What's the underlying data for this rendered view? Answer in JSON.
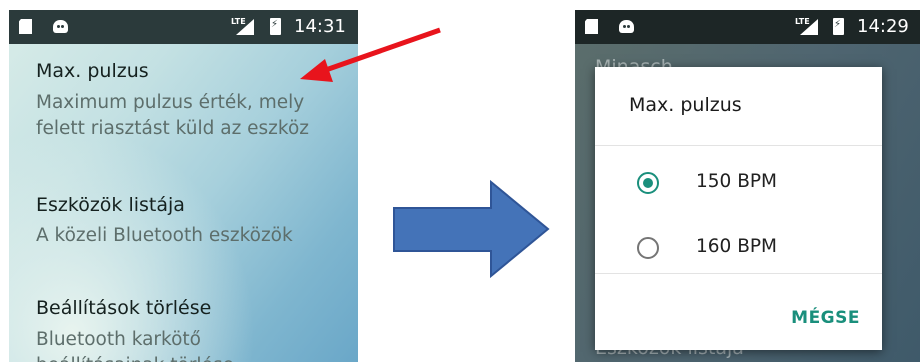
{
  "left_screen": {
    "status": {
      "network": "LTE",
      "time": "14:31",
      "icons": [
        "sim-icon",
        "android-icon",
        "signal-icon",
        "battery-charging-icon"
      ]
    },
    "preferences": [
      {
        "title": "Max. pulzus",
        "summary_line1": "Maximum pulzus érték, mely",
        "summary_line2": "felett riasztást küld az eszköz"
      },
      {
        "title": "Eszközök listája",
        "summary_line1": "A közeli Bluetooth eszközök"
      },
      {
        "title": "Beállítások törlése",
        "summary_line1": "Bluetooth karkötő",
        "summary_line2": "beállításainak törlése"
      }
    ]
  },
  "right_screen": {
    "status": {
      "network": "LTE",
      "time": "14:29",
      "icons": [
        "sim-icon",
        "android-icon",
        "signal-icon",
        "battery-charging-icon"
      ]
    },
    "background_top_text": "Minasch",
    "background_bottom_text": "Eszközök listája",
    "dialog": {
      "title": "Max. pulzus",
      "options": [
        {
          "label": "150 BPM",
          "selected": true
        },
        {
          "label": "160 BPM",
          "selected": false
        }
      ],
      "cancel_label": "MÉGSE"
    }
  },
  "annotations": {
    "arrow_color": "#e8141c",
    "big_arrow_color": "#3d6fb0",
    "accent": "#1a8f7c"
  }
}
